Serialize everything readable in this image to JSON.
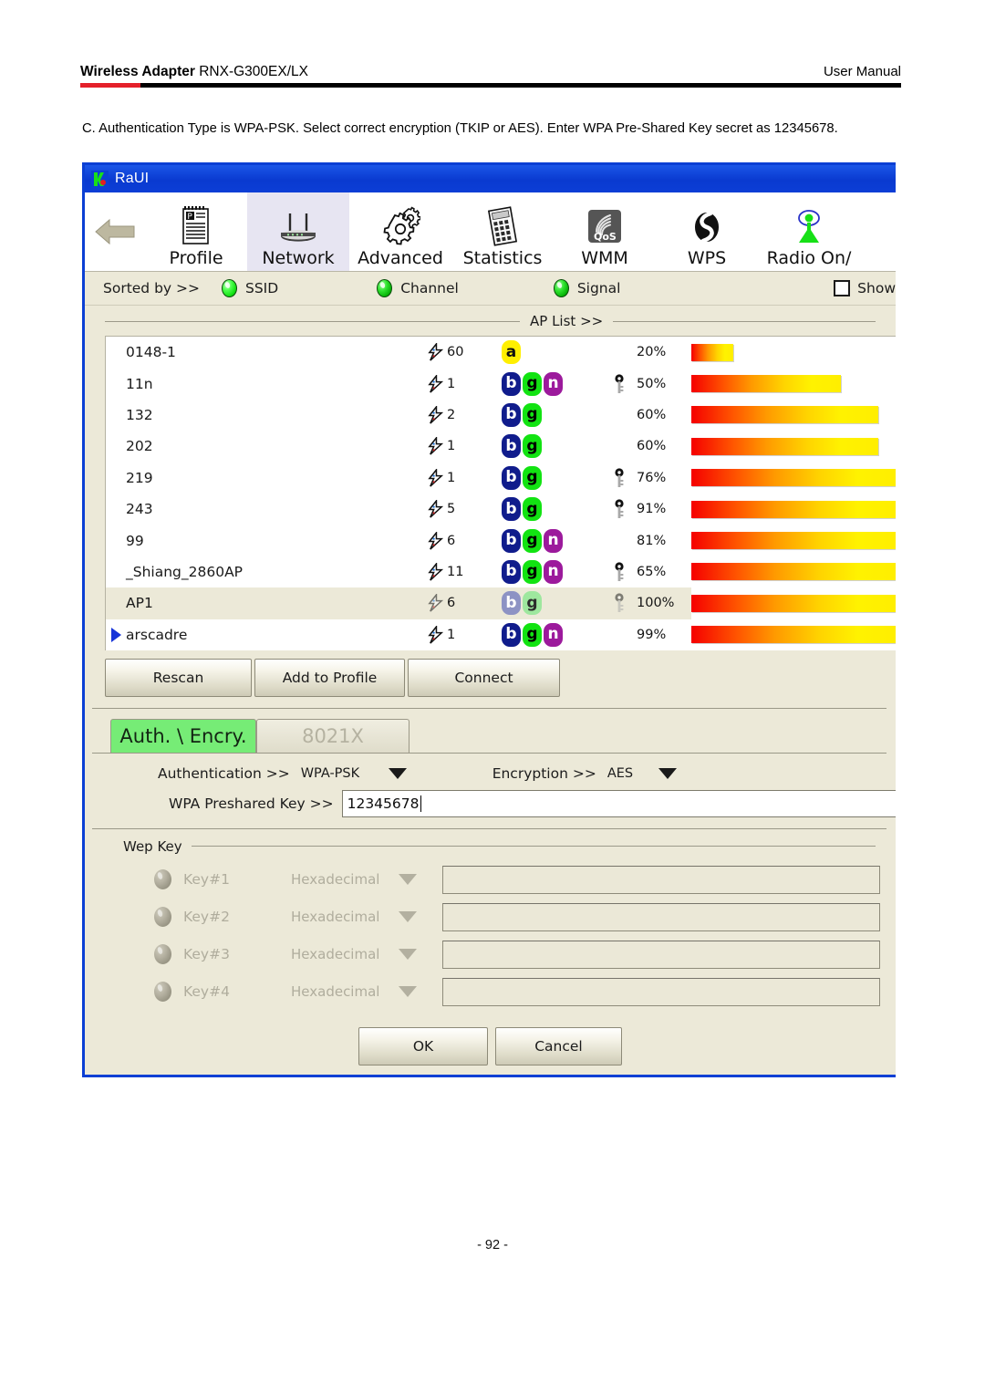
{
  "document": {
    "header_left_strong": "Wireless Adapter",
    "header_left_normal": " RNX-G300EX/LX",
    "header_right": "User Manual",
    "intro": "C. Authentication Type is WPA-PSK. Select correct encryption (TKIP or AES). Enter WPA Pre-Shared Key secret as 12345678.",
    "page_number": "- 92 -",
    "accent_red": "#e4202a",
    "accent_black": "#000000"
  },
  "app": {
    "title": "RaUI",
    "titlebar_color": "#0b3fd4",
    "toolbar": {
      "back_label": "",
      "items": [
        {
          "label": "Profile",
          "icon": "profile-icon",
          "active": false
        },
        {
          "label": "Network",
          "icon": "router-icon",
          "active": true
        },
        {
          "label": "Advanced",
          "icon": "gears-icon",
          "active": false
        },
        {
          "label": "Statistics",
          "icon": "calculator-icon",
          "active": false
        },
        {
          "label": "WMM",
          "icon": "qos-icon",
          "active": false
        },
        {
          "label": "WPS",
          "icon": "wps-icon",
          "active": false
        },
        {
          "label": "Radio On/",
          "icon": "antenna-icon",
          "active": false
        }
      ]
    },
    "sort_bar": {
      "label": "Sorted by >>",
      "options": [
        {
          "label": "SSID",
          "selected": true
        },
        {
          "label": "Channel",
          "selected": false
        },
        {
          "label": "Signal",
          "selected": false
        }
      ],
      "show_label": "Show",
      "show_checked": false
    },
    "ap_list": {
      "title": "AP List >>",
      "rows": [
        {
          "ssid": "0148-1",
          "channel": "60",
          "bands": [
            "a"
          ],
          "secured": false,
          "signal_label": "20%",
          "signal": 20,
          "selected": false,
          "current": false
        },
        {
          "ssid": "11n",
          "channel": "1",
          "bands": [
            "b",
            "g",
            "n"
          ],
          "secured": true,
          "signal_label": "50%",
          "signal": 50,
          "selected": false,
          "current": false
        },
        {
          "ssid": "132",
          "channel": "2",
          "bands": [
            "b",
            "g"
          ],
          "secured": false,
          "signal_label": "60%",
          "signal": 60,
          "selected": false,
          "current": false
        },
        {
          "ssid": "202",
          "channel": "1",
          "bands": [
            "b",
            "g"
          ],
          "secured": false,
          "signal_label": "60%",
          "signal": 60,
          "selected": false,
          "current": false
        },
        {
          "ssid": "219",
          "channel": "1",
          "bands": [
            "b",
            "g"
          ],
          "secured": true,
          "signal_label": "76%",
          "signal": 76,
          "selected": false,
          "current": false
        },
        {
          "ssid": "243",
          "channel": "5",
          "bands": [
            "b",
            "g"
          ],
          "secured": true,
          "signal_label": "91%",
          "signal": 91,
          "selected": false,
          "current": false
        },
        {
          "ssid": "99",
          "channel": "6",
          "bands": [
            "b",
            "g",
            "n"
          ],
          "secured": false,
          "signal_label": "81%",
          "signal": 81,
          "selected": false,
          "current": false
        },
        {
          "ssid": "_Shiang_2860AP",
          "channel": "11",
          "bands": [
            "b",
            "g",
            "n"
          ],
          "secured": true,
          "signal_label": "65%",
          "signal": 65,
          "selected": false,
          "current": false
        },
        {
          "ssid": "AP1",
          "channel": "6",
          "bands": [
            "b",
            "g"
          ],
          "secured": true,
          "signal_label": "100%",
          "signal": 100,
          "selected": false,
          "current": true
        },
        {
          "ssid": "arscadre",
          "channel": "1",
          "bands": [
            "b",
            "g",
            "n"
          ],
          "secured": false,
          "signal_label": "99%",
          "signal": 99,
          "selected": true,
          "current": false
        }
      ]
    },
    "actions": {
      "rescan": "Rescan",
      "add_to_profile": "Add to Profile",
      "connect": "Connect"
    },
    "tabs": [
      {
        "label": "Auth. \\ Encry.",
        "active": true
      },
      {
        "label": "8021X",
        "active": false
      }
    ],
    "auth": {
      "authentication_label": "Authentication >>",
      "authentication_value": "WPA-PSK",
      "encryption_label": "Encryption >>",
      "encryption_value": "AES",
      "psk_label": "WPA Preshared Key >>",
      "psk_value": "12345678"
    },
    "wep": {
      "group_title": "Wep Key",
      "rows": [
        {
          "key_label": "Key#1",
          "format": "Hexadecimal",
          "value": ""
        },
        {
          "key_label": "Key#2",
          "format": "Hexadecimal",
          "value": ""
        },
        {
          "key_label": "Key#3",
          "format": "Hexadecimal",
          "value": ""
        },
        {
          "key_label": "Key#4",
          "format": "Hexadecimal",
          "value": ""
        }
      ]
    },
    "dialog_buttons": {
      "ok": "OK",
      "cancel": "Cancel"
    }
  }
}
